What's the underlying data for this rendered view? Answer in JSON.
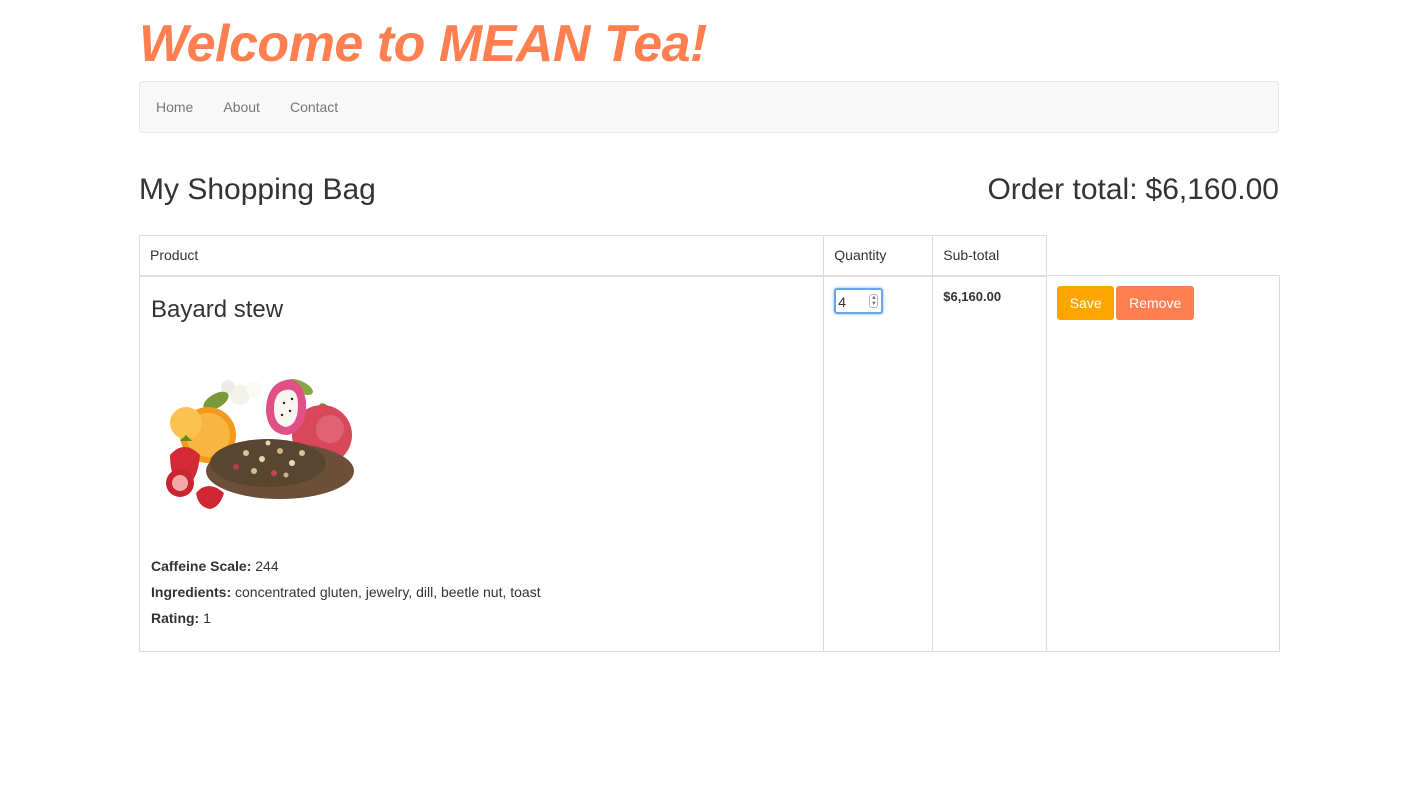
{
  "site": {
    "title": "Welcome to MEAN Tea!"
  },
  "nav": {
    "items": [
      {
        "label": "Home"
      },
      {
        "label": "About"
      },
      {
        "label": "Contact"
      }
    ]
  },
  "bag": {
    "title": "My Shopping Bag",
    "order_total_label": "Order total:",
    "order_total_value": "$6,160.00"
  },
  "table": {
    "headers": {
      "product": "Product",
      "quantity": "Quantity",
      "subtotal": "Sub-total"
    },
    "rows": [
      {
        "name": "Bayard stew",
        "image_icon": "tea-product-image",
        "caffeine_label": "Caffeine Scale:",
        "caffeine_value": "244",
        "ingredients_label": "Ingredients:",
        "ingredients_value": "concentrated gluten, jewelry, dill, beetle nut, toast",
        "rating_label": "Rating:",
        "rating_value": "1",
        "quantity": "4",
        "subtotal": "$6,160.00",
        "save_label": "Save",
        "remove_label": "Remove"
      }
    ]
  },
  "colors": {
    "brand": "#ff7f50",
    "save_button": "#ffa500",
    "remove_button": "#ff7f50",
    "navbar_bg": "#f8f8f8",
    "focus_ring": "#6aa5e8"
  }
}
